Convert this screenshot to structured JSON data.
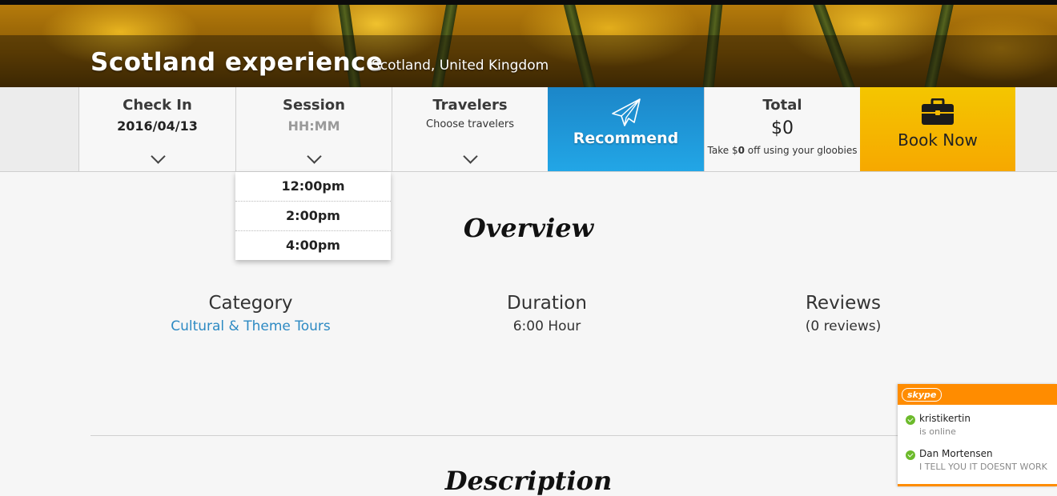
{
  "hero": {
    "title": "Scotland experience",
    "location": "Scotland, United Kingdom"
  },
  "booking": {
    "check_in": {
      "label": "Check In",
      "value": "2016/04/13"
    },
    "session": {
      "label": "Session",
      "placeholder": "HH:MM"
    },
    "travelers": {
      "label": "Travelers",
      "hint": "Choose travelers"
    },
    "recommend": {
      "label": "Recommend",
      "icon": "paper-plane-icon"
    },
    "total": {
      "label": "Total",
      "amount": "$0",
      "note_prefix": "Take $",
      "note_bold": "0",
      "note_suffix": " off using your gloobies"
    },
    "book_now": {
      "label": "Book Now",
      "icon": "briefcase-icon"
    }
  },
  "session_options": [
    "12:00pm",
    "2:00pm",
    "4:00pm"
  ],
  "overview": {
    "title": "Overview",
    "category": {
      "label": "Category",
      "value": "Cultural & Theme Tours"
    },
    "duration": {
      "label": "Duration",
      "value": "6:00 Hour"
    },
    "reviews": {
      "label": "Reviews",
      "value": "(0 reviews)"
    }
  },
  "description": {
    "title": "Description"
  },
  "skype": {
    "brand": "skype",
    "contacts": [
      {
        "name": "kristikertin",
        "status": "is online"
      },
      {
        "name": "Dan Mortensen",
        "status": "I TELL YOU IT DOESNT WORK"
      }
    ]
  },
  "colors": {
    "recommend": "#1c86c8",
    "book_now": "#f4c600",
    "link": "#2d8ac3",
    "skype_orange": "#ff8c00",
    "online_green": "#6cba2b"
  }
}
